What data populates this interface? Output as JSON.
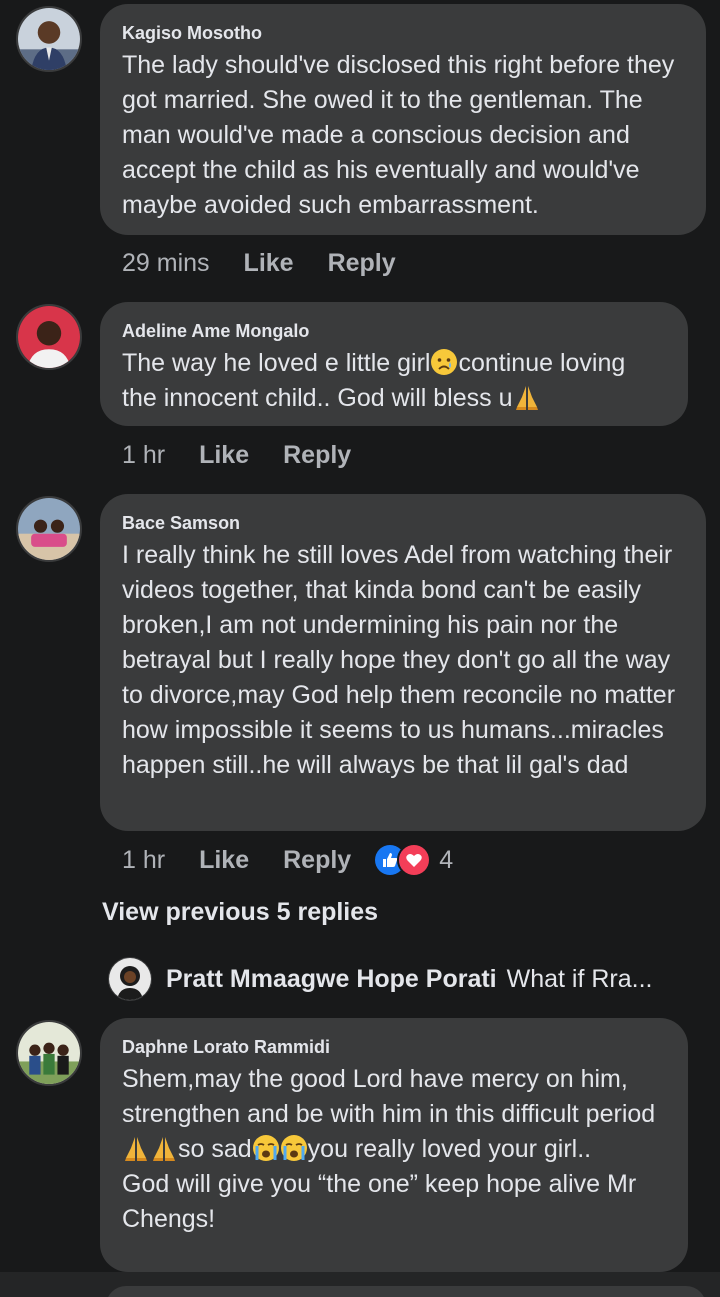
{
  "comments": [
    {
      "author": "Kagiso Mosotho",
      "text": "The lady should've disclosed this right before they got married. She owed it to the gentleman. The man would've made a conscious decision and accept the child as his eventually and would've maybe avoided such embarrassment.",
      "time": "29 mins",
      "like": "Like",
      "reply": "Reply"
    },
    {
      "author": "Adeline Ame Mongalo",
      "text_a": "The way he loved e little girl",
      "text_b": "continue loving the innocent child.. God will bless u",
      "emoji_1": "sad-face-emoji",
      "emoji_2": "praying-hands-emoji",
      "time": "1 hr",
      "like": "Like",
      "reply": "Reply"
    },
    {
      "author": "Bace Samson",
      "text": "I really think he still loves Adel from watching their videos together, that kinda bond can't be easily broken,I am not undermining his pain nor the betrayal but I really hope they don't go all the way to divorce,may God help them reconcile no matter how impossible it seems to us humans...miracles happen still..he will always be that lil gal's dad",
      "time": "1 hr",
      "like": "Like",
      "reply": "Reply",
      "reaction_count": "4",
      "reaction_icons": [
        "like-reaction-icon",
        "love-reaction-icon"
      ]
    },
    {
      "author": "Daphne Lorato Rammidi",
      "text_a": "Shem,may the good Lord have mercy on him, strengthen and be with him in this difficult period",
      "text_b": "so sad",
      "text_c": "you really loved your girl..",
      "text_d": "God will give you “the one” keep hope alive Mr Chengs!",
      "emojis": [
        "praying-hands-emoji",
        "crying-face-emoji"
      ]
    }
  ],
  "view_previous": "View previous 5 replies",
  "reply_preview": {
    "author": "Pratt Mmaagwe Hope Porati",
    "text": "What if Rra..."
  },
  "colors": {
    "background": "#18191a",
    "bubble": "#3a3b3c",
    "text": "#e4e6eb",
    "muted": "#b0b3b8",
    "like_blue": "#1877f2",
    "love_red": "#f33e58"
  }
}
